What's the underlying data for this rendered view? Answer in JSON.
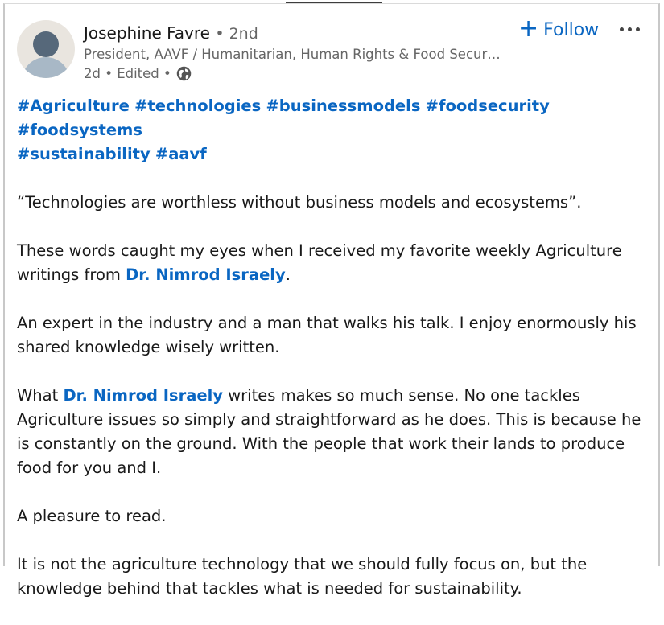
{
  "post": {
    "author": {
      "name": "Josephine Favre",
      "degree": "• 2nd",
      "headline": "President, AAVF / Humanitarian, Human Rights & Food Securit…",
      "time": "2d • Edited •",
      "avatar_icon": "default-person-avatar",
      "visibility_icon": "globe-icon"
    },
    "actions": {
      "follow_plus": "+",
      "follow_label": "Follow",
      "more_icon": "ellipsis-icon"
    },
    "hashtags": [
      "#Agriculture",
      "#technologies",
      "#businessmodels",
      "#foodsecurity",
      "#foodsystems",
      "#sustainability",
      "#aavf"
    ],
    "quote": "“Technologies are worthless without business models and ecosystems”.",
    "para2_a": "These words caught my eyes when I received my favorite weekly Agriculture writings from ",
    "mention": "Dr. Nimrod Israely",
    "para2_b": ".",
    "para3": "An expert in the industry and a man that walks his talk. I enjoy enormously his shared knowledge wisely written.",
    "para4_a": "What ",
    "para4_b": " writes makes so much sense. No one tackles Agriculture issues so simply and straightforward as he does. This is because he is constantly on the ground. With the people that work their lands to produce food for you and I.",
    "para5": "A pleasure to read.",
    "para6": "It is not the agriculture technology that we should fully focus on, but the knowledge behind that tackles what is needed for sustainability."
  },
  "colors": {
    "link_blue": "#0a66c2",
    "secondary_text": "#666666",
    "primary_text": "#191919"
  }
}
